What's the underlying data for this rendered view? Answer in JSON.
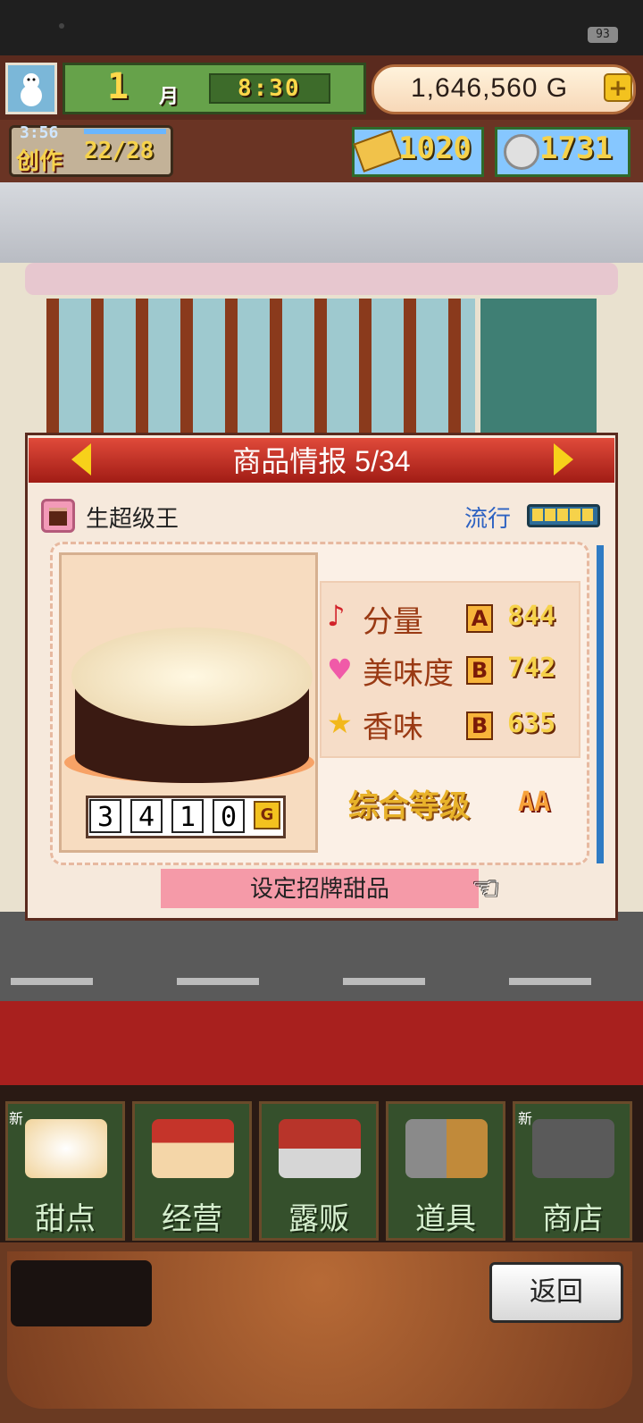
{
  "status_bar": {
    "battery": "93"
  },
  "hud": {
    "month_number": "1",
    "month_unit": "月",
    "clock": "8:30",
    "money": "1,646,560 G",
    "create_timer": "3:56",
    "create_label": "创作",
    "create_count": "22/28",
    "tickets": "1020",
    "coins": "1731"
  },
  "dialog": {
    "title": "商品情报 5/34",
    "item_name": "生超级王",
    "trend_label": "流行",
    "trend_level": 5,
    "price_digits": [
      "3",
      "4",
      "1",
      "0"
    ],
    "price_unit": "G",
    "stats": [
      {
        "label": "分量",
        "icon": "music-note-icon",
        "grade": "A",
        "value": "844"
      },
      {
        "label": "美味度",
        "icon": "heart-icon",
        "grade": "B",
        "value": "742"
      },
      {
        "label": "香味",
        "icon": "star-icon",
        "grade": "B",
        "value": "635"
      }
    ],
    "overall_label": "综合等级",
    "overall_grade": "AA",
    "action_button": "设定招牌甜品"
  },
  "menu": [
    {
      "label": "甜点",
      "new": "新"
    },
    {
      "label": "经营",
      "new": ""
    },
    {
      "label": "露贩",
      "new": ""
    },
    {
      "label": "道具",
      "new": ""
    },
    {
      "label": "商店",
      "new": "新"
    }
  ],
  "back_button": "返回"
}
